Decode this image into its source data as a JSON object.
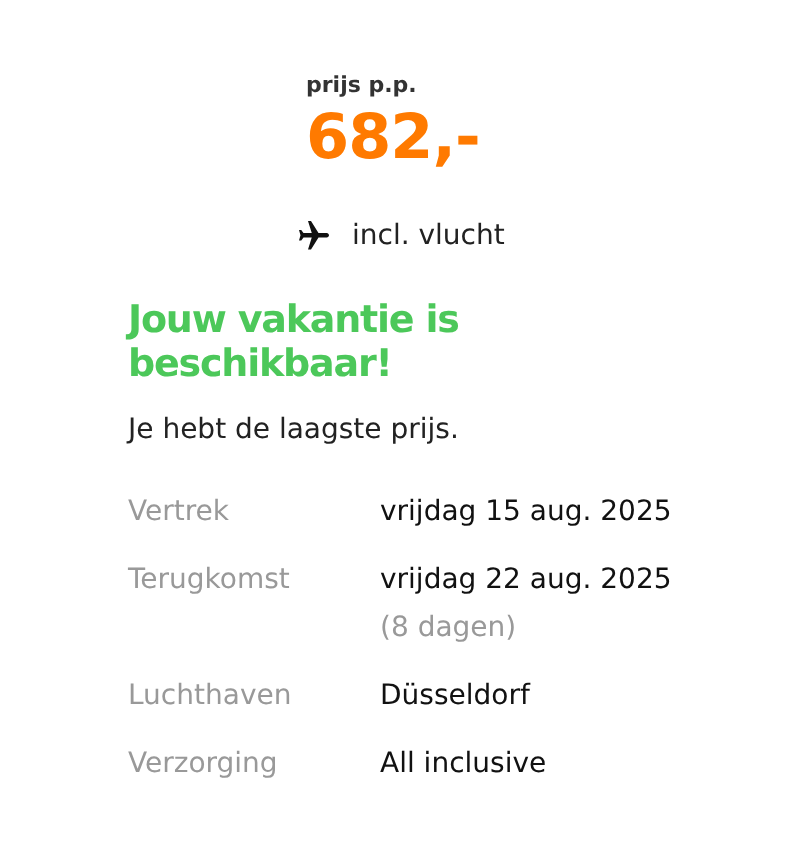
{
  "price": {
    "label": "prijs p.p.",
    "amount": "682,-"
  },
  "includes": {
    "text": "incl. vlucht"
  },
  "availability": {
    "title": "Jouw vakantie is beschikbaar!",
    "subtitle": "Je hebt de laagste prijs."
  },
  "details": [
    {
      "label": "Vertrek",
      "value": "vrijdag 15 aug. 2025"
    },
    {
      "label": "Terugkomst",
      "value": "vrijdag 22 aug. 2025",
      "note": "(8 dagen)"
    },
    {
      "label": "Luchthaven",
      "value": "Düsseldorf"
    },
    {
      "label": "Verzorging",
      "value": "All inclusive"
    }
  ]
}
